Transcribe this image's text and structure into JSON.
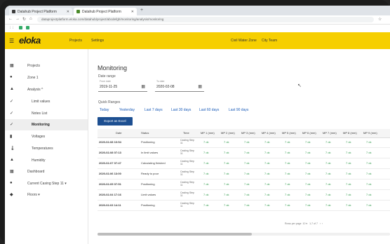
{
  "browser": {
    "tabs": [
      {
        "label": "Datahub Project Platform"
      },
      {
        "label": "Datahub Project Platform"
      }
    ],
    "url": "dataprojectplatform.eloka.com/datahub/project/abcdefgh/monitoring/analysis/monitoring"
  },
  "header": {
    "logo": "eloka",
    "nav": [
      "Projects",
      "Settings"
    ],
    "right": [
      "Civil Water Zone",
      "City Team"
    ]
  },
  "sidebar": {
    "items": [
      {
        "label": "Projects",
        "icon": "grid-icon"
      },
      {
        "label": "Zone 1",
        "icon": "pin-icon"
      },
      {
        "label": "Analysis ^",
        "icon": "chart-icon"
      },
      {
        "label": "Limit values",
        "icon": "check-icon"
      },
      {
        "label": "Notes List",
        "icon": "check-icon"
      },
      {
        "label": "Monitoring",
        "icon": "check-icon"
      },
      {
        "label": "Voltages",
        "icon": "bar-icon"
      },
      {
        "label": "Temperatures",
        "icon": "thermometer-icon"
      },
      {
        "label": "Humidity",
        "icon": "drop-icon"
      },
      {
        "label": "Dashboard",
        "icon": "dashboard-icon"
      },
      {
        "label": "Current Casing Step 11 ▾",
        "icon": "pin-icon"
      },
      {
        "label": "Floors ▾",
        "icon": "layers-icon"
      }
    ]
  },
  "main": {
    "title": "Monitoring",
    "date_range_label": "Date range",
    "from": {
      "label": "From date",
      "value": "2019-11-25"
    },
    "to": {
      "label": "To date",
      "value": "2020-02-08"
    },
    "quick_ranges_label": "Quick Ranges",
    "quick_ranges": [
      "Today",
      "Yesterday",
      "Last 7 days",
      "Last 30 days",
      "Last 60 days",
      "Last 90 days"
    ],
    "export_label": "Export as Excel",
    "table": {
      "headers": [
        "Date",
        "Status",
        "Time",
        "MP 1 (mm)",
        "MP 2 (mm)",
        "MP 3 (mm)",
        "MP 4 (mm)",
        "MP 5 (mm)",
        "MP 6 (mm)",
        "MP 7 (mm)",
        "MP 8 (mm)",
        "MP 9 (mm)"
      ],
      "rows": [
        {
          "date": "2020-02-08 10:54",
          "status": "Positioning",
          "state": "Casting Step 11",
          "vals": [
            "7 ok",
            "7 ok",
            "7 ok",
            "7 ok",
            "7 ok",
            "7 ok",
            "7 ok",
            "7 ok",
            "7 ok"
          ]
        },
        {
          "date": "2020-02-08 07:13",
          "status": "In limit values",
          "state": "Casting Step 11",
          "vals": [
            "7 ok",
            "7 ok",
            "7 ok",
            "7 ok",
            "7 ok",
            "7 ok",
            "7 ok",
            "7 ok",
            "7 ok"
          ]
        },
        {
          "date": "2020-02-07 07:47",
          "status": "Calculating finished",
          "state": "Casting Step 11",
          "vals": [
            "7 ok",
            "7 ok",
            "7 ok",
            "7 ok",
            "7 ok",
            "7 ok",
            "7 ok",
            "7 ok",
            "7 ok"
          ]
        },
        {
          "date": "2020-02-06 13:00",
          "status": "Ready to pour",
          "state": "Casting Step 11",
          "vals": [
            "7 ok",
            "7 ok",
            "7 ok",
            "7 ok",
            "7 ok",
            "7 ok",
            "7 ok",
            "7 ok",
            "7 ok"
          ]
        },
        {
          "date": "2020-02-05 07:51",
          "status": "Positioning",
          "state": "Casting Step 11",
          "vals": [
            "7 ok",
            "7 ok",
            "7 ok",
            "7 ok",
            "7 ok",
            "7 ok",
            "7 ok",
            "7 ok",
            "7 ok"
          ]
        },
        {
          "date": "2020-02-04 17:16",
          "status": "Limit values",
          "state": "Casting Step 11",
          "vals": [
            "7 ok",
            "7 ok",
            "7 ok",
            "7 ok",
            "7 ok",
            "7 ok",
            "7 ok",
            "7 ok",
            "7 ok"
          ]
        },
        {
          "date": "2020-02-03 14:11",
          "status": "Positioning",
          "state": "Casting Step 11",
          "vals": [
            "7 ok",
            "7 ok",
            "7 ok",
            "7 ok",
            "7 ok",
            "7 ok",
            "7 ok",
            "7 ok",
            "7 ok"
          ]
        }
      ]
    },
    "pager": {
      "rows_label": "Rows per page",
      "rows_value": "10",
      "range": "1-7 of 7"
    }
  }
}
